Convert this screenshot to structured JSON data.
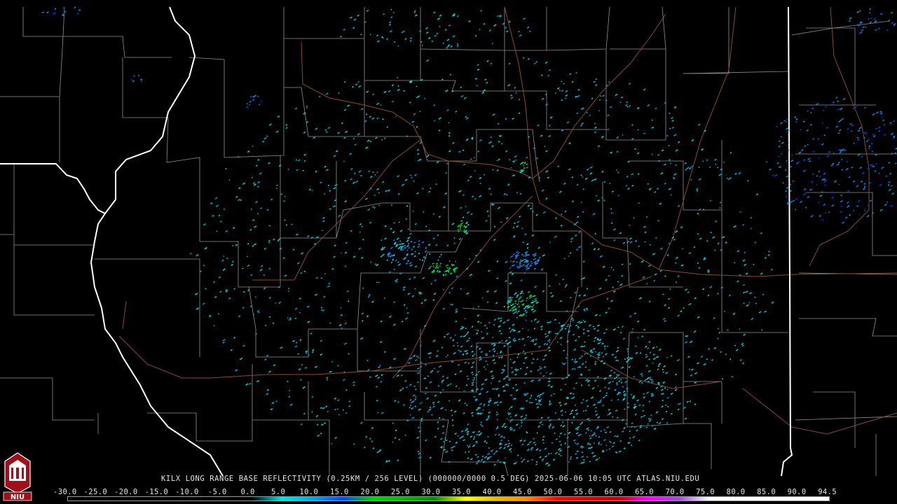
{
  "product": {
    "caption": "KILX LONG RANGE BASE REFLECTIVITY (0.25KM / 256 LEVEL) (000000/0000 0.5 DEG) 2025-06-06 10:05 UTC  ATLAS.NIU.EDU",
    "logo_text": "NIU"
  },
  "scale": {
    "unit": "",
    "labels": [
      "-30.0",
      "-25.0",
      "-20.0",
      "-15.0",
      "-10.0",
      "-5.0",
      "0.0",
      "5.0",
      "10.0",
      "15.0",
      "20.0",
      "25.0",
      "30.0",
      "35.0",
      "40.0",
      "45.0",
      "50.0",
      "55.0",
      "60.0",
      "65.0",
      "70.0",
      "75.0",
      "80.0",
      "85.0",
      "90.0",
      "94.5"
    ],
    "stops": [
      {
        "value": -30,
        "color": "#000000"
      },
      {
        "value": 0,
        "color": "#000000"
      },
      {
        "value": 5,
        "color": "#00e5e5"
      },
      {
        "value": 10,
        "color": "#00a8e0"
      },
      {
        "value": 15,
        "color": "#0046ff"
      },
      {
        "value": 20,
        "color": "#00d200"
      },
      {
        "value": 25,
        "color": "#00b400"
      },
      {
        "value": 30,
        "color": "#008c00"
      },
      {
        "value": 35,
        "color": "#ffff00"
      },
      {
        "value": 40,
        "color": "#e6bc00"
      },
      {
        "value": 45,
        "color": "#ff8c00"
      },
      {
        "value": 50,
        "color": "#ff0000"
      },
      {
        "value": 55,
        "color": "#d40000"
      },
      {
        "value": 60,
        "color": "#c00000"
      },
      {
        "value": 65,
        "color": "#ff00ff"
      },
      {
        "value": 70,
        "color": "#9955cc"
      },
      {
        "value": 75,
        "color": "#ffffff"
      },
      {
        "value": 94.5,
        "color": "#ffffff"
      }
    ]
  },
  "map_style": {
    "background": "#000000",
    "state_border": "#ffffff",
    "county_border": "#8f8f8f",
    "highway": "#8b4a2b",
    "echo_colors": [
      "#00e5e5",
      "#00c8f0",
      "#00a8e0",
      "#1e78ff",
      "#0046ff",
      "#00d200"
    ]
  }
}
